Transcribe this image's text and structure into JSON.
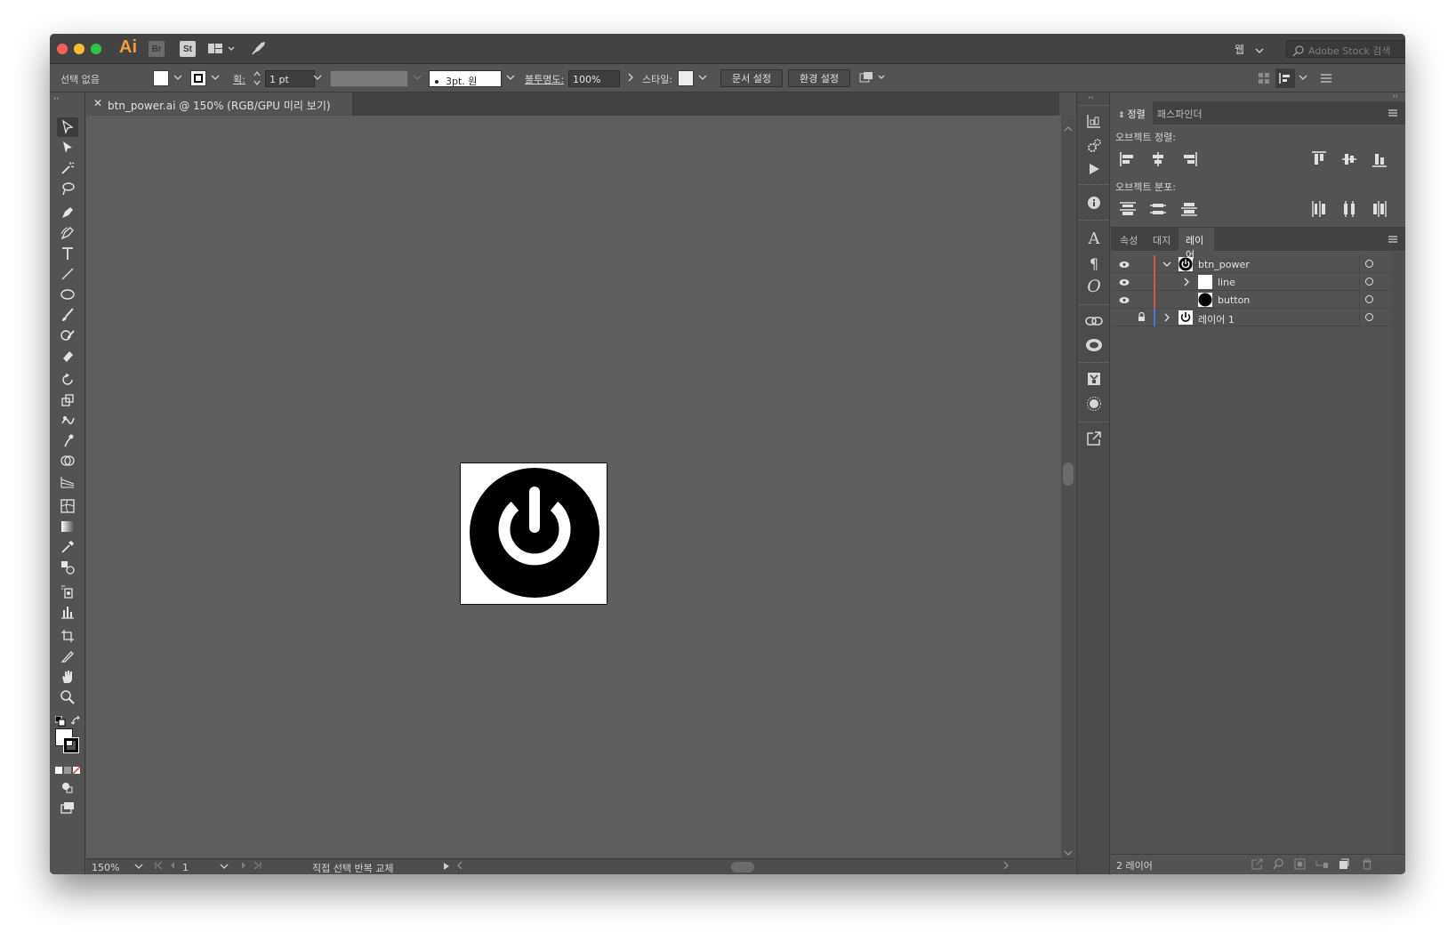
{
  "app": {
    "logo_text": "Ai",
    "bridge_label": "Br",
    "stock_label": "St",
    "workspace_label": "웹",
    "search_placeholder": "Adobe Stock 검색"
  },
  "control_bar": {
    "selection_status": "선택 없음",
    "stroke_label": "획:",
    "stroke_value": "1 pt",
    "brush_value": "3pt. 원",
    "opacity_label": "불투명도:",
    "opacity_value": "100%",
    "style_label": "스타일:",
    "doc_setup_button": "문서 설정",
    "preferences_button": "환경 설정"
  },
  "document": {
    "tab_title": "btn_power.ai @ 150% (RGB/GPU 미리 보기)",
    "zoom_value": "150%",
    "artboard_number": "1",
    "status_text": "직접 선택 반복 교체"
  },
  "align_panel": {
    "tab_align": "정렬",
    "tab_pathfinder": "패스파인더",
    "align_objects_label": "오브젝트 정렬:",
    "distribute_objects_label": "오브젝트 분포:"
  },
  "layers_panel": {
    "tab_properties": "속성",
    "tab_artboards": "대지",
    "tab_layers": "레이어",
    "rows": [
      {
        "name": "btn_power"
      },
      {
        "name": "line"
      },
      {
        "name": "button"
      },
      {
        "name": "레이어 1"
      }
    ],
    "footer_count": "2 레이어"
  },
  "colors": {
    "accent_red": "#d9534f",
    "accent_blue": "#4a78d6",
    "app_orange": "#f29d38"
  }
}
